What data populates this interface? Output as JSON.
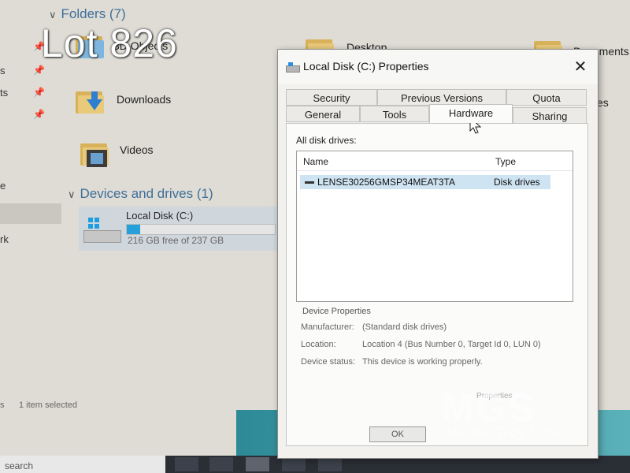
{
  "overlay": {
    "lot": "Lot 826"
  },
  "explorer": {
    "folders_header": "Folders (7)",
    "folders": [
      {
        "label": "3D Objects"
      },
      {
        "label": "Desktop"
      },
      {
        "label": "Documents"
      },
      {
        "label": "Downloads"
      },
      {
        "label": "Videos"
      }
    ],
    "left_nav_fragments": [
      "s",
      "ts",
      "e",
      "rk"
    ],
    "devices_header": "Devices and drives (1)",
    "drive": {
      "name": "Local Disk (C:)",
      "free": "216 GB free of 237 GB",
      "used_fraction": 0.09
    },
    "status": {
      "items": "s",
      "selected": "1 item selected"
    },
    "behind_fragment": "es"
  },
  "taskbar": {
    "search": "search"
  },
  "dialog": {
    "title": "Local Disk (C:) Properties",
    "tabs_row1": [
      "Security",
      "Previous Versions",
      "Quota"
    ],
    "tabs_row2": [
      "General",
      "Tools",
      "Hardware",
      "Sharing"
    ],
    "active_tab": "Hardware",
    "all_disk_drives_label": "All disk drives:",
    "columns": {
      "name": "Name",
      "type": "Type"
    },
    "drives": [
      {
        "name": "LENSE30256GMSP34MEAT3TA",
        "type": "Disk drives"
      }
    ],
    "device_properties": {
      "title": "Device Properties",
      "rows": [
        {
          "key": "Manufacturer:",
          "value": "(Standard disk drives)"
        },
        {
          "key": "Location:",
          "value": "Location 4 (Bus Number 0, Target Id 0, LUN 0)"
        },
        {
          "key": "Device status:",
          "value": "This device is working properly."
        }
      ],
      "properties_button": "Properties"
    },
    "ok_button": "OK"
  },
  "watermark": {
    "logo": "MGS",
    "text": "Mason Gray Strange"
  }
}
